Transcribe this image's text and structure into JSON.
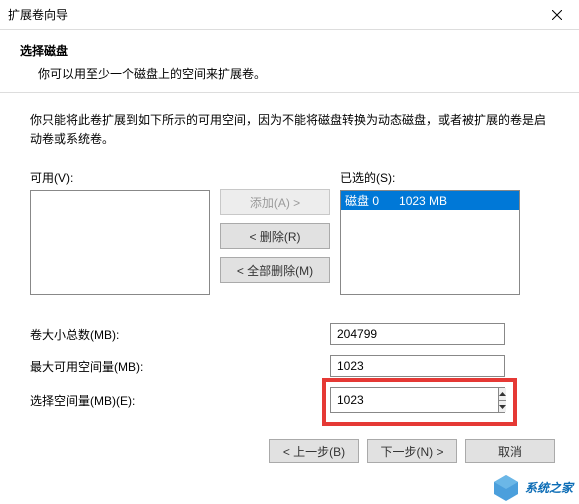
{
  "titlebar": {
    "title": "扩展卷向导"
  },
  "header": {
    "title": "选择磁盘",
    "desc": "你可以用至少一个磁盘上的空间来扩展卷。"
  },
  "instruction": "你只能将此卷扩展到如下所示的可用空间，因为不能将磁盘转换为动态磁盘，或者被扩展的卷是启动卷或系统卷。",
  "available": {
    "label": "可用(V):",
    "items": []
  },
  "selected": {
    "label": "已选的(S):",
    "items": [
      {
        "disk": "磁盘 0",
        "size": "1023 MB"
      }
    ]
  },
  "buttons": {
    "add": "添加(A) >",
    "remove": "< 删除(R)",
    "removeAll": "< 全部删除(M)",
    "back": "< 上一步(B)",
    "next": "下一步(N) >",
    "cancel": "取消"
  },
  "fields": {
    "totalLabel": "卷大小总数(MB):",
    "totalValue": "204799",
    "maxLabel": "最大可用空间量(MB):",
    "maxValue": "1023",
    "selectLabel": "选择空间量(MB)(E):",
    "selectValue": "1023"
  },
  "watermark": "系统之家"
}
